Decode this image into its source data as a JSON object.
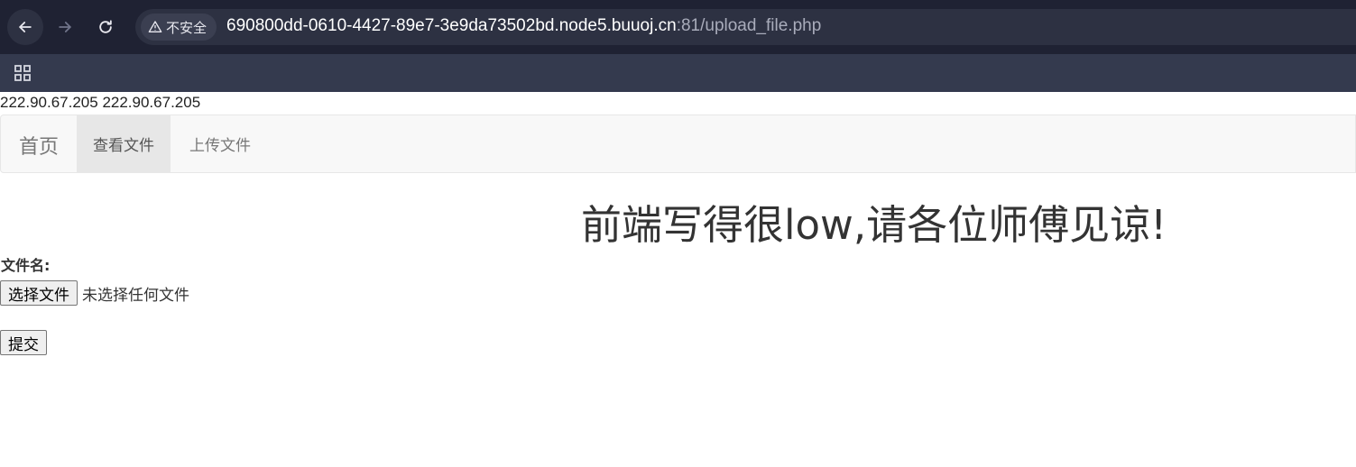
{
  "browser": {
    "security_label": "不安全",
    "url_host": "690800dd-0610-4427-89e7-3e9da73502bd.node5.buuoj.cn",
    "url_rest": ":81/upload_file.php",
    "icons": [
      "back-arrow-icon",
      "forward-arrow-icon",
      "reload-icon",
      "warning-triangle-icon",
      "apps-grid-icon"
    ]
  },
  "page": {
    "ip_text": "222.90.67.205 222.90.67.205",
    "navbar": {
      "brand": "首页",
      "items": [
        {
          "label": "查看文件",
          "active": true
        },
        {
          "label": "上传文件",
          "active": false
        }
      ]
    },
    "heading": "前端写得很low,请各位师傅见谅!",
    "form": {
      "file_label": "文件名:",
      "choose_button": "选择文件",
      "file_status": "未选择任何文件",
      "submit_button": "提交"
    }
  },
  "colors": {
    "toolbar_bg": "#1f2233",
    "bookmarks_bg": "#343a4e",
    "navbar_bg": "#f8f8f8",
    "navbar_active_bg": "#e7e7e7"
  }
}
